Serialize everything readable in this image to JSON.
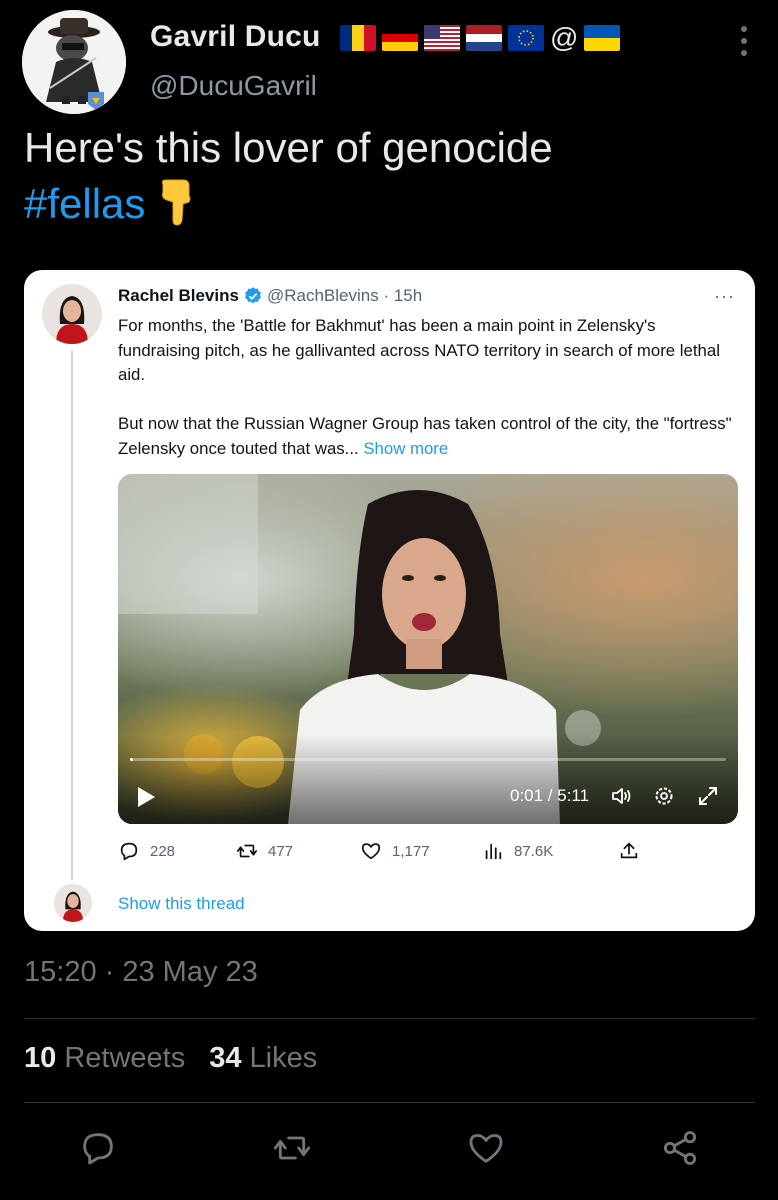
{
  "tweet": {
    "author_name": "Gavril Ducu",
    "author_handle": "@DucuGavril",
    "flag_separator": "@",
    "text_line1": "Here's this lover of genocide",
    "hashtag": "#fellas",
    "timestamp": "15:20 · 23 May 23",
    "retweets_count": "10",
    "retweets_label": "Retweets",
    "likes_count": "34",
    "likes_label": "Likes"
  },
  "quote": {
    "name": "Rachel Blevins",
    "handle_time": "@RachBlevins · 15h",
    "more": "···",
    "paragraph1": "For months, the 'Battle for Bakhmut' has been a main point in Zelensky's fundraising pitch, as he gallivanted across NATO territory in search of more lethal aid.",
    "paragraph2": "But now that the Russian Wagner Group has taken control of the city, the \"fortress\" Zelensky once touted that was...",
    "show_more": "Show more",
    "video_time": "0:01 / 5:11",
    "video_progress": 0.003,
    "replies": "228",
    "retweets": "477",
    "likes": "1,177",
    "views": "87.6K",
    "show_thread": "Show this thread"
  },
  "icons": [
    "more-icon",
    "verified-icon",
    "play-icon",
    "volume-icon",
    "settings-icon",
    "fullscreen-icon",
    "reply-icon",
    "retweet-icon",
    "like-icon",
    "views-icon",
    "share-icon",
    "pointing-down-emoji"
  ],
  "colors": {
    "background": "#000000",
    "accent": "#1d9bf0",
    "secondary_text": "#71767b",
    "card_background": "#ffffff"
  }
}
